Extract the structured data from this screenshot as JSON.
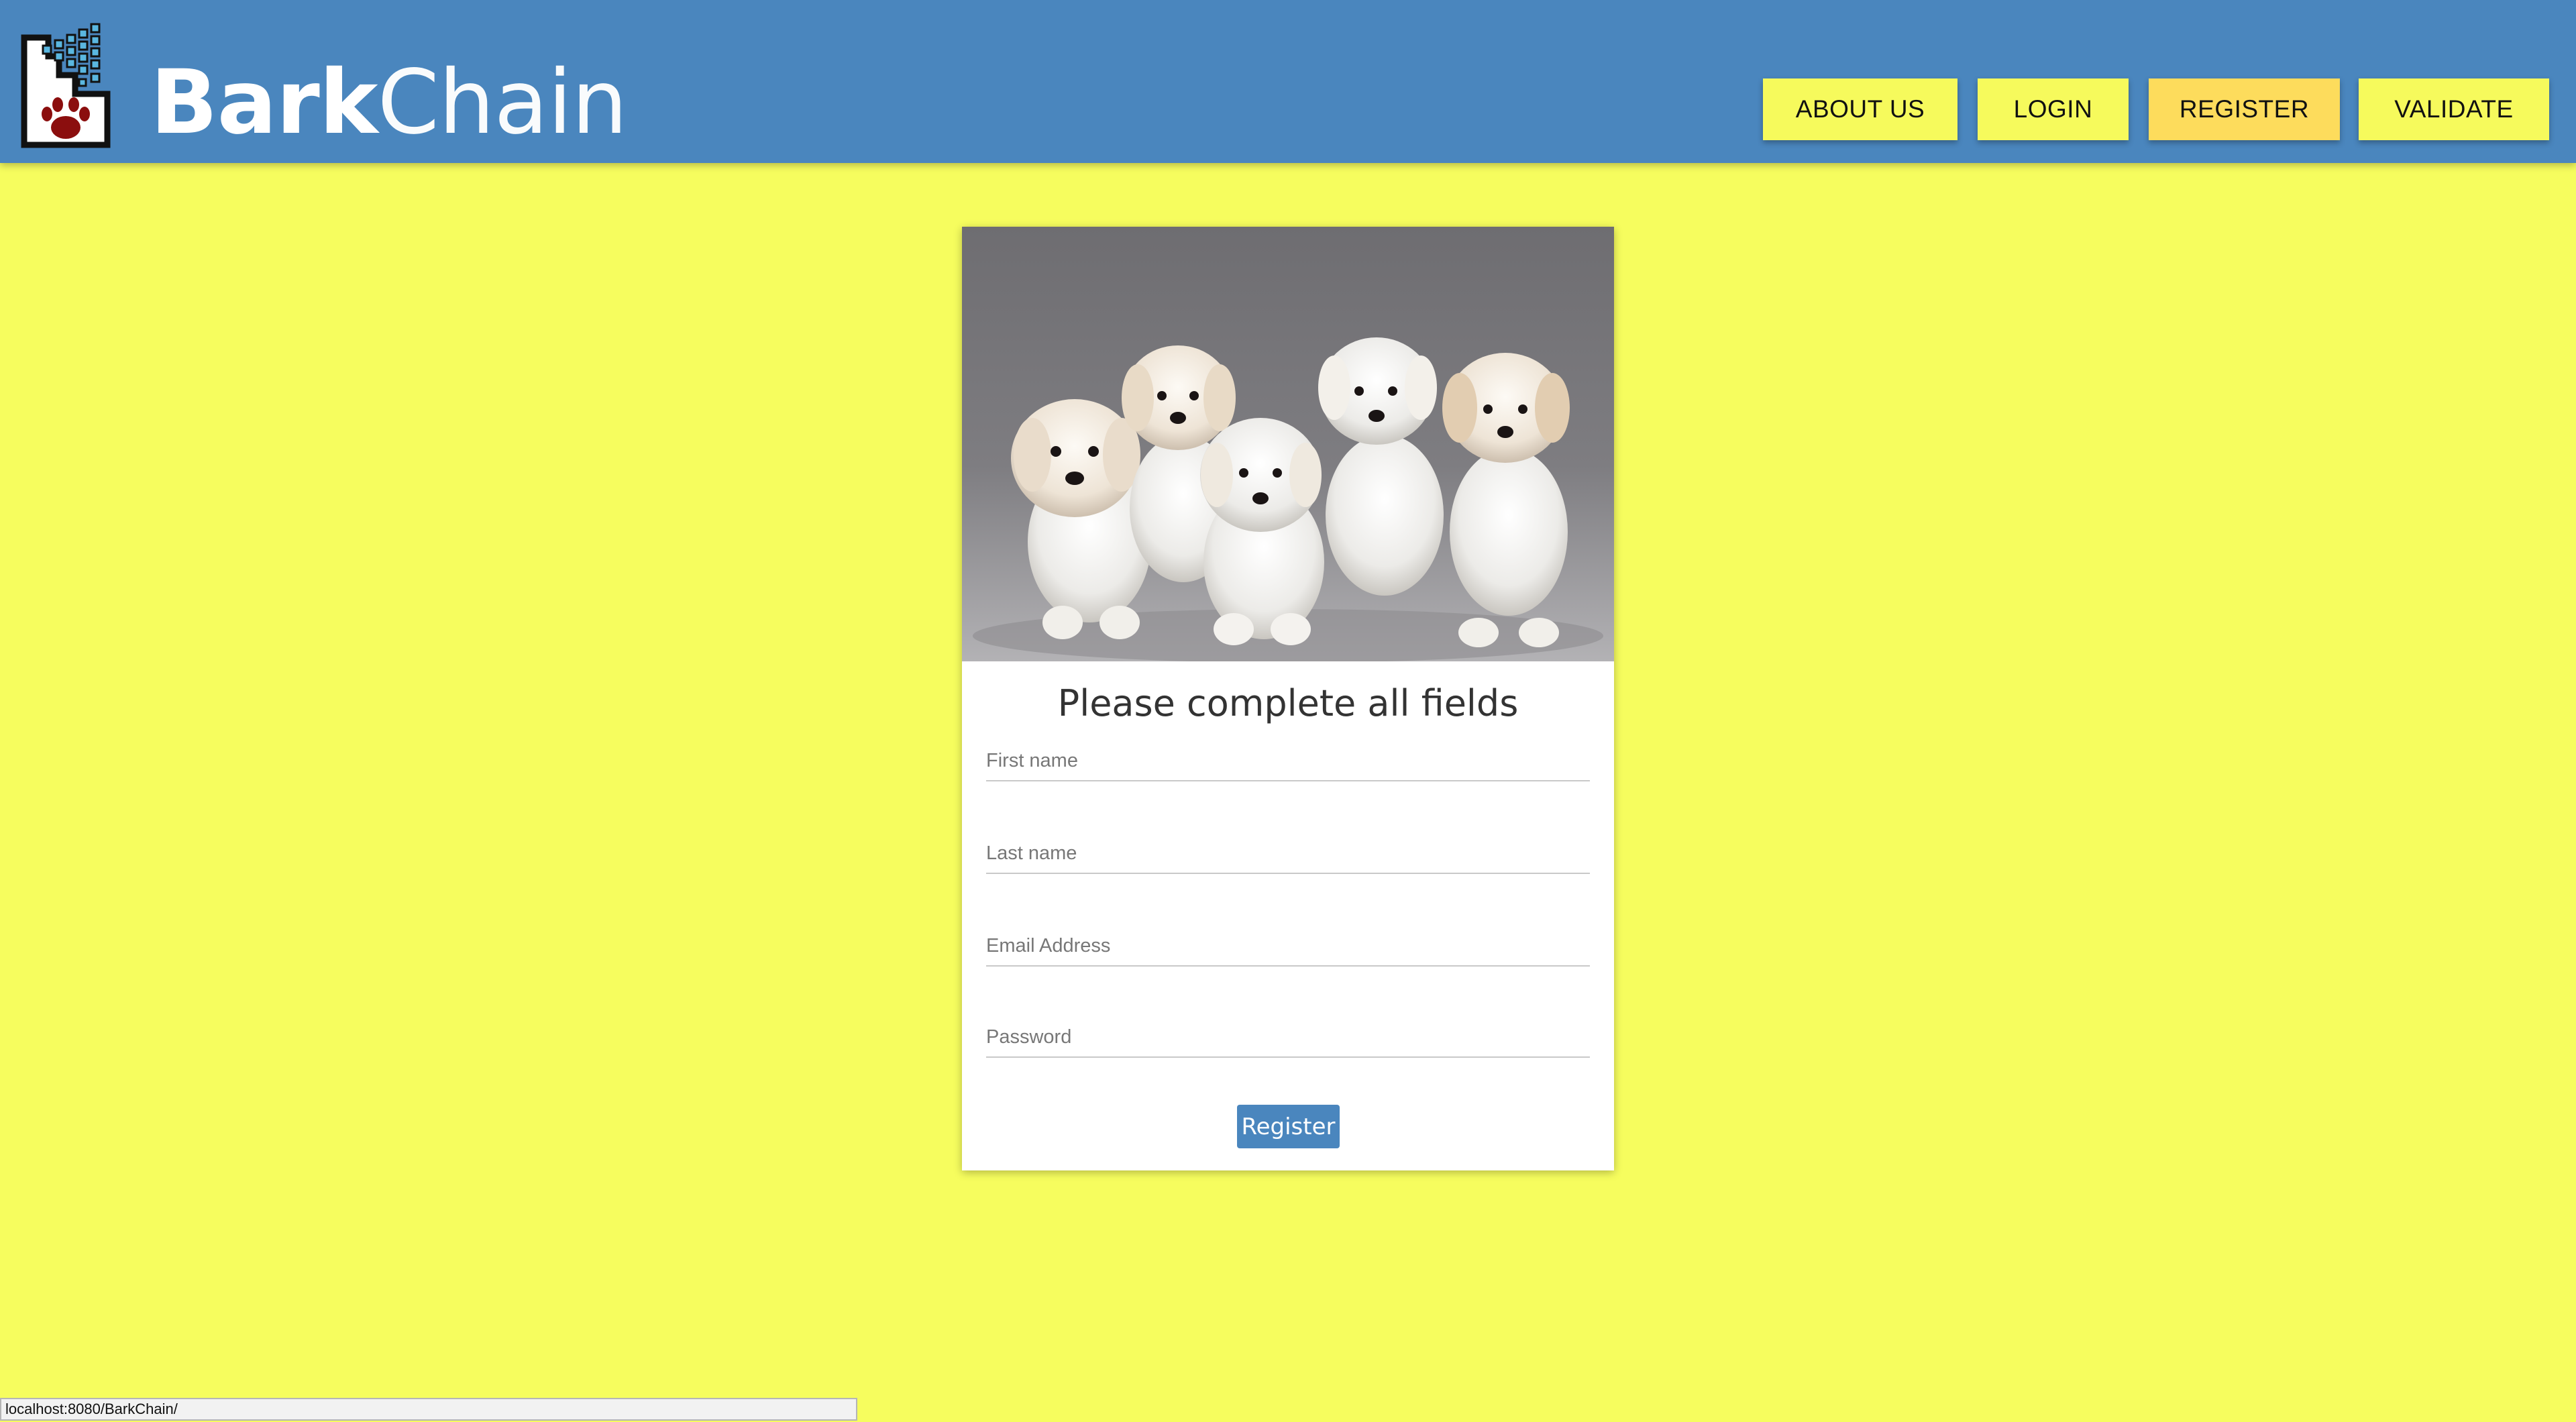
{
  "header": {
    "brand_bold": "Bark",
    "brand_light": "Chain",
    "nav": {
      "about": "ABOUT US",
      "login": "LOGIN",
      "register": "REGISTER",
      "validate": "VALIDATE"
    },
    "active_nav": "register"
  },
  "form": {
    "title": "Please complete all fields",
    "first_name_placeholder": "First name",
    "last_name_placeholder": "Last name",
    "email_placeholder": "Email Address",
    "password_placeholder": "Password",
    "submit_label": "Register"
  },
  "status_bar": {
    "url": "localhost:8080/BarkChain/"
  },
  "colors": {
    "page_background": "#f6fd5e",
    "header_background": "#4a86be",
    "nav_button": "#f6fa5c",
    "nav_button_active": "#fddc5c",
    "accent": "#4a86be",
    "paw": "#8b0e0e"
  },
  "icons": {
    "logo": "blockchain-paw-logo"
  }
}
